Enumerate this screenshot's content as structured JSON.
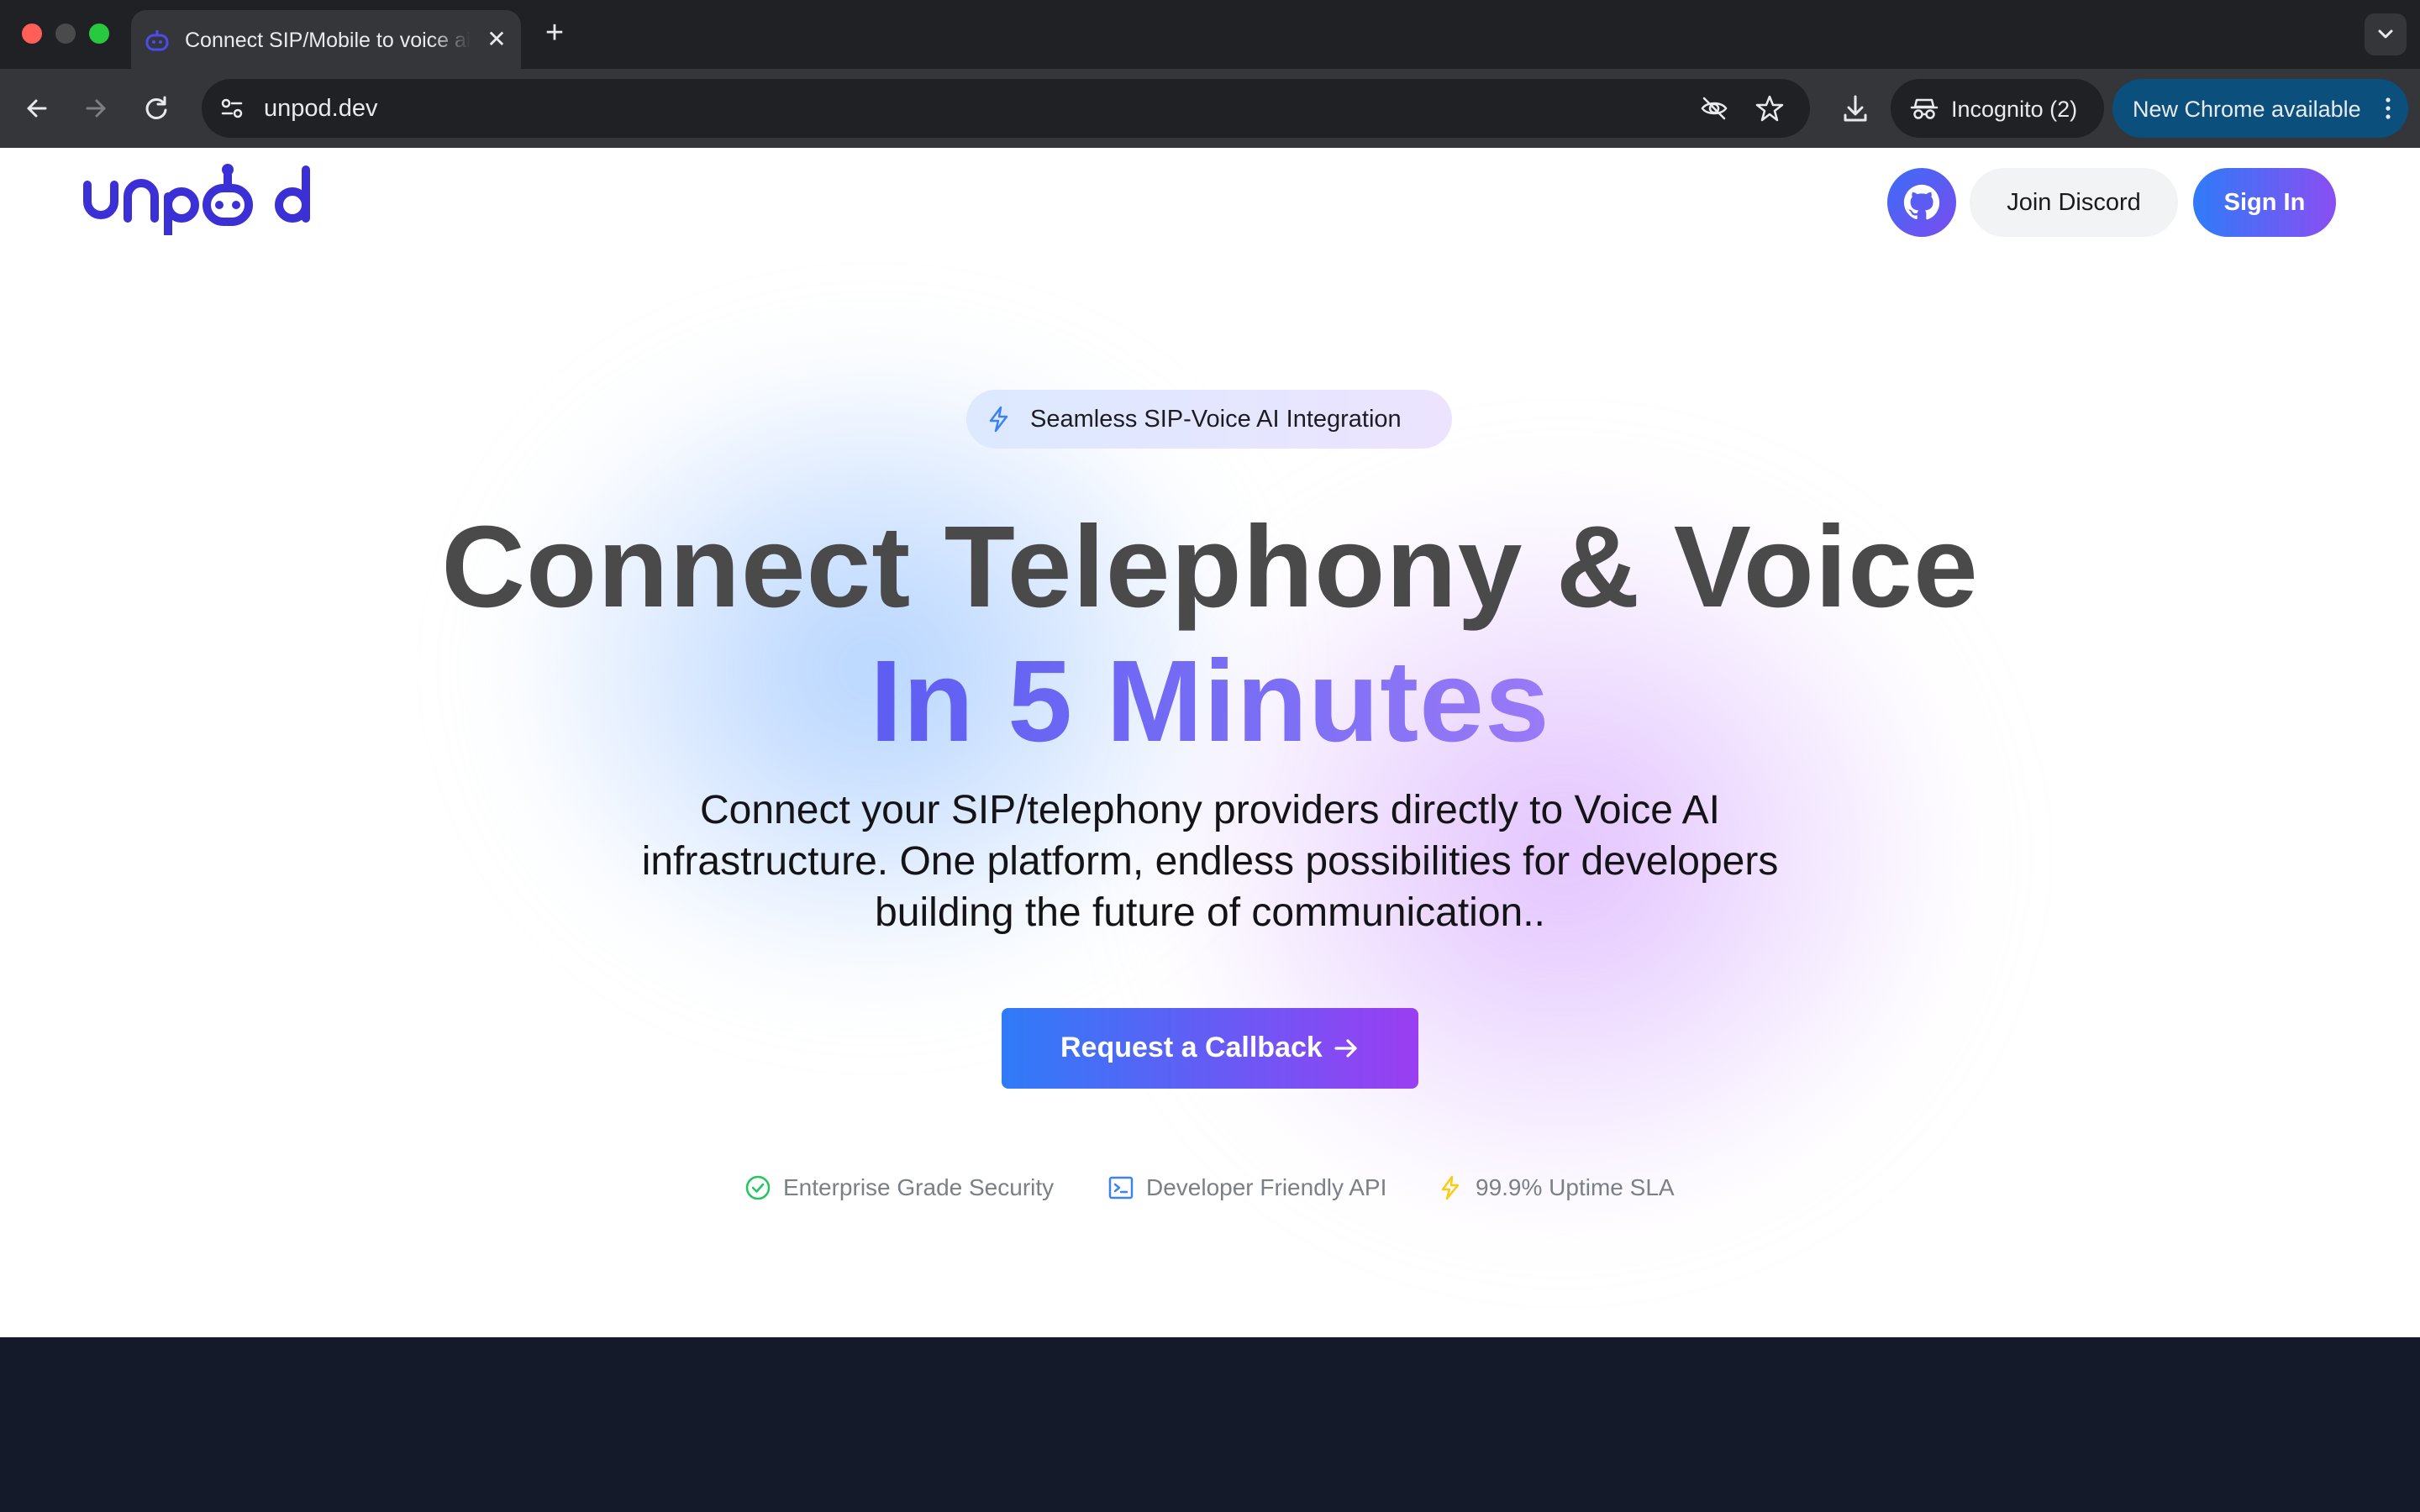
{
  "browser": {
    "tab_title": "Connect SIP/Mobile to voice ai",
    "url": "unpod.dev",
    "incognito_label": "Incognito (2)",
    "update_label": "New Chrome available"
  },
  "header": {
    "brand": "unpod",
    "discord_label": "Join Discord",
    "signin_label": "Sign In"
  },
  "hero": {
    "badge_text": "Seamless SIP-Voice AI Integration",
    "title_line1": "Connect Telephony & Voice",
    "title_line2": "In 5 Minutes",
    "subtitle_lines": [
      "Connect your SIP/telephony providers directly to Voice AI",
      "infrastructure. One platform, endless possibilities for developers",
      "building the future of communication.."
    ],
    "cta_label": "Request a Callback",
    "features": [
      {
        "label": "Enterprise Grade Security",
        "icon": "check-circle-icon",
        "color": "#22c55e"
      },
      {
        "label": "Developer Friendly API",
        "icon": "terminal-icon",
        "color": "#3b82f6"
      },
      {
        "label": "99.9% Uptime SLA",
        "icon": "lightning-icon",
        "color": "#facc15"
      }
    ]
  },
  "colors": {
    "brand": "#3b2fd6",
    "accent_gradient_start": "#2f7bf8",
    "accent_gradient_end": "#9a3ef2",
    "dark_band": "#151a2b"
  }
}
